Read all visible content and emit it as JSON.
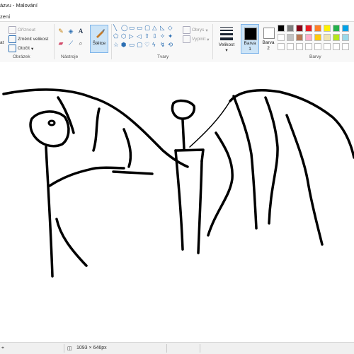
{
  "window": {
    "title": "ázvu - Malování"
  },
  "menu": {
    "label": "zení"
  },
  "ribbon": {
    "image_group": {
      "label": "Obrázek",
      "partial_label": "at",
      "crop": "Oříznout",
      "resize": "Změnit velikost",
      "rotate": "Otočit"
    },
    "tools_group": {
      "label": "Nástroje",
      "text_tool": "A"
    },
    "brushes": {
      "label": "Štětce"
    },
    "shapes_group": {
      "label": "Tvary",
      "outline": "Obrys",
      "fill": "Vyplnit",
      "shapes": [
        "╲",
        "◯",
        "▭",
        "▭",
        "▢",
        "△",
        "◺",
        "◇",
        "⬠",
        "⬡",
        "▷",
        "◁",
        "⇧",
        "⇩",
        "✧",
        "✦",
        "☆",
        "⬢",
        "▭",
        "▢",
        "♡",
        "ϟ",
        "↯",
        "⟲"
      ]
    },
    "size": {
      "label": "Velikost"
    },
    "color1": {
      "label_line1": "Barva",
      "label_line2": "1",
      "value": "#000000"
    },
    "color2": {
      "label_line1": "Barva",
      "label_line2": "2",
      "value": "#ffffff"
    },
    "palette": {
      "label": "Barvy",
      "row1": [
        "#000000",
        "#7f7f7f",
        "#880015",
        "#ed1c24",
        "#ff7f27",
        "#fff200",
        "#22b14c",
        "#00a2e8"
      ],
      "row2": [
        "#ffffff",
        "#c3c3c3",
        "#b97a57",
        "#ffaec9",
        "#ffc90e",
        "#efe4b0",
        "#b5e61d",
        "#99d9ea"
      ],
      "row3": [
        "#ffffff",
        "#ffffff",
        "#ffffff",
        "#ffffff",
        "#ffffff",
        "#ffffff",
        "#ffffff",
        "#ffffff"
      ]
    }
  },
  "statusbar": {
    "dimensions": "1093 × 646px"
  }
}
